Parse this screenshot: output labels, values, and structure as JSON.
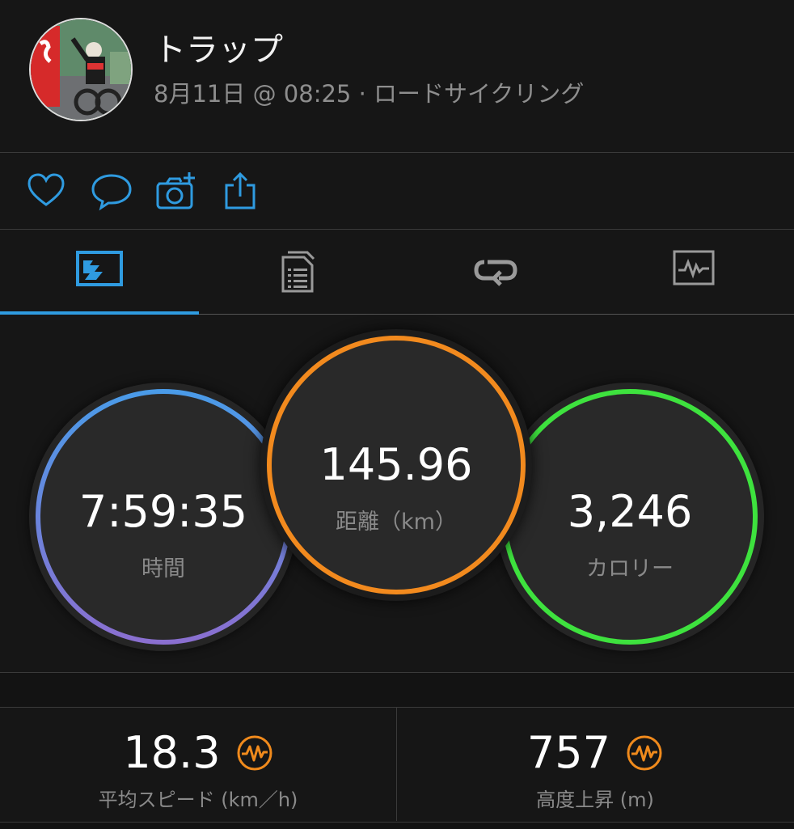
{
  "activity": {
    "user_name": "トラップ",
    "meta": "8月11日 @ 08:25 · ロードサイクリング"
  },
  "actions": [
    "heart-icon",
    "comment-icon",
    "camera-add-icon",
    "share-icon"
  ],
  "tabs": [
    {
      "icon": "overview-icon",
      "selected": true
    },
    {
      "icon": "details-icon",
      "selected": false
    },
    {
      "icon": "laps-icon",
      "selected": false
    },
    {
      "icon": "charts-icon",
      "selected": false
    }
  ],
  "summary": {
    "time": {
      "value": "7:59:35",
      "label": "時間"
    },
    "distance": {
      "value": "145.96",
      "label": "距離（km）"
    },
    "calories": {
      "value": "3,246",
      "label": "カロリー"
    }
  },
  "stats": {
    "avg_speed": {
      "value": "18.3",
      "label": "平均スピード (km／h)"
    },
    "elevation_gain": {
      "value": "757",
      "label": "高度上昇 (m)"
    }
  },
  "colors": {
    "accent_blue": "#2f9be0",
    "time_ring_start": "#4a9be8",
    "time_ring_end": "#8a6fd0",
    "distance_ring": "#f28a1e",
    "calories_ring": "#3ee23e",
    "badge_orange": "#f08a1c"
  }
}
